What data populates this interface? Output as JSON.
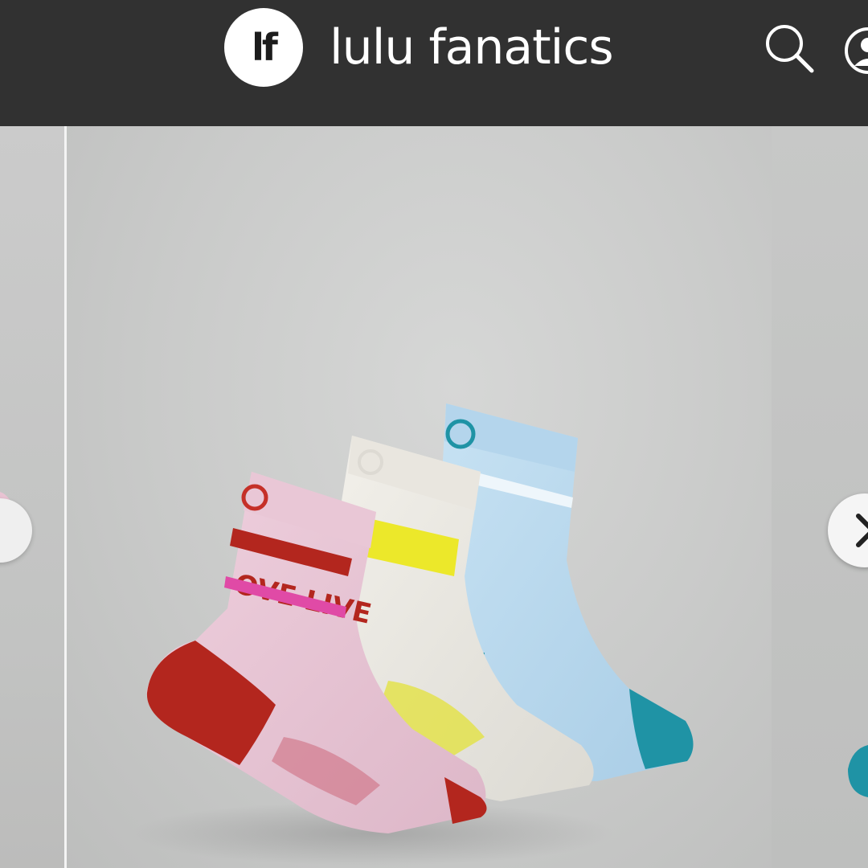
{
  "header": {
    "logo_text": "lf",
    "site_title": "lulu fanatics",
    "background": "#313131",
    "icons": {
      "search": "search-icon",
      "profile": "user-profile-icon"
    }
  },
  "carousel": {
    "main_image": {
      "subject": "three-pack-crew-socks",
      "sock_colors": [
        "#e8c7d8",
        "#ece9e2",
        "#b9d9ee"
      ],
      "accent_colors": [
        "#b3261e",
        "#e6e21f",
        "#1f93a5"
      ],
      "sock_print_text": "OVE LIVE"
    },
    "prev_button_icon": "chevron-left-icon",
    "next_button_icon": "chevron-right-icon"
  }
}
